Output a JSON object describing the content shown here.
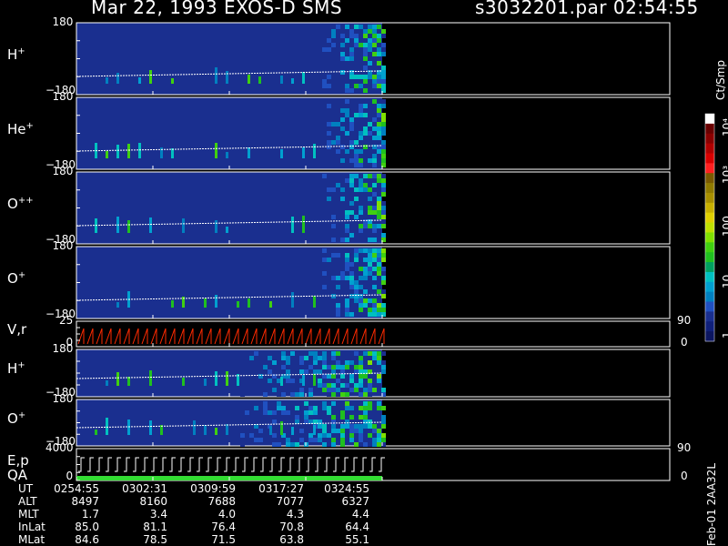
{
  "header": {
    "title": "Mar 22, 1993   EXOS-D SMS",
    "file_time": "s3032201.par  02:54:55"
  },
  "side_code": "Feb-01 2AA32L",
  "colors": {
    "background": "#000000",
    "panel_fill": "#1a2f8f",
    "trace": "#ffffff",
    "velocity_trace": "#ff2a00",
    "qa_bar": "#33dd33"
  },
  "chart_data": {
    "type": "heatmap",
    "panels": [
      {
        "name": "H+",
        "label": "H",
        "sup": "+",
        "ytop": "180",
        "ybot": "−180"
      },
      {
        "name": "He+",
        "label": "He",
        "sup": "+",
        "ytop": "180",
        "ybot": "−180"
      },
      {
        "name": "O++",
        "label": "O",
        "sup": "++",
        "ytop": "180",
        "ybot": "−180"
      },
      {
        "name": "O+",
        "label": "O",
        "sup": "+",
        "ytop": "180",
        "ybot": "−180"
      },
      {
        "name": "V,r",
        "label": "V,r",
        "sup": "",
        "ytop": "25",
        "ybot": "0",
        "yright_top": "90",
        "yright_bot": "0"
      },
      {
        "name": "H+ (2)",
        "label": "H",
        "sup": "+",
        "ytop": "180",
        "ybot": "−180"
      },
      {
        "name": "O+ (2)",
        "label": "O",
        "sup": "+",
        "ytop": "180",
        "ybot": "−180"
      },
      {
        "name": "E,p QA",
        "label": "E,p",
        "label2": "QA",
        "sup": "",
        "ytop": "4000",
        "ybot": "0",
        "yright_top": "90",
        "yright_bot": "0"
      }
    ],
    "colorbar": {
      "unit": "Ct/Smp",
      "ticks": [
        "10⁴",
        "10³",
        "100",
        "10",
        "1"
      ],
      "colors": [
        "#ffffff",
        "#6a0000",
        "#8a0000",
        "#b00000",
        "#d80000",
        "#ff2020",
        "#7a5a00",
        "#8f7a00",
        "#a88f00",
        "#c8b000",
        "#e0d000",
        "#c0e000",
        "#80e000",
        "#40d010",
        "#20c020",
        "#00a060",
        "#00c0c0",
        "#00a0d0",
        "#0080c0",
        "#2050c0",
        "#1a2f8f",
        "#10207a",
        "#0c1660"
      ]
    },
    "time_axis": {
      "rows": [
        {
          "label": "UT",
          "values": [
            "0254:55",
            "0302:31",
            "0309:59",
            "0317:27",
            "0324:55"
          ]
        },
        {
          "label": "ALT",
          "values": [
            "8497",
            "8160",
            "7688",
            "7077",
            "6327"
          ]
        },
        {
          "label": "MLT",
          "values": [
            "1.7",
            "3.4",
            "4.0",
            "4.3",
            "4.4"
          ]
        },
        {
          "label": "InLat",
          "values": [
            "85.0",
            "81.1",
            "76.4",
            "70.8",
            "64.4"
          ]
        },
        {
          "label": "MLat",
          "values": [
            "84.6",
            "78.5",
            "71.5",
            "63.8",
            "55.1"
          ]
        }
      ]
    },
    "data_extent_fraction": 0.515
  }
}
